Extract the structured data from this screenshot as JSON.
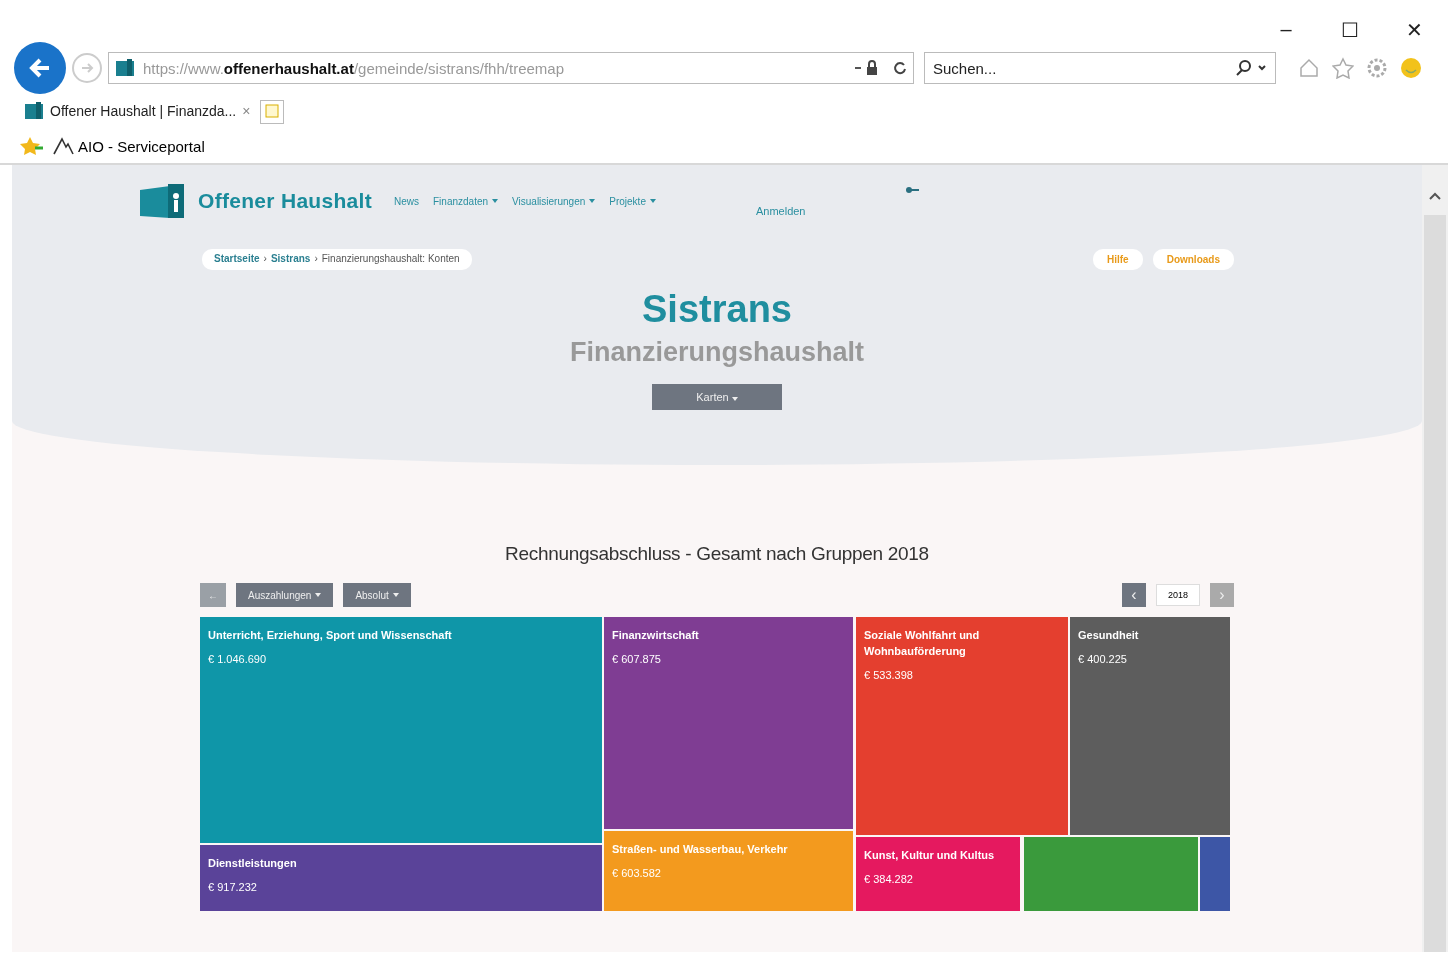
{
  "browser": {
    "window_controls": [
      "–",
      "☐",
      "✕"
    ],
    "url": "https://www.**offenerhaushalt.at**/gemeinde/sistrans/fhh/treemap",
    "search": {
      "placeholder": "Suchen..."
    },
    "tabs": [
      {
        "label": "Offener Haushalt | Finanzda...",
        "close": "×",
        "selected": true
      }
    ],
    "favorites": [
      "AIO - Serviceportal"
    ]
  },
  "site": {
    "logo_text": "Offener Haushalt",
    "nav": [
      {
        "label": "News",
        "dropdown": false
      },
      {
        "label": "Finanzdaten",
        "dropdown": true
      },
      {
        "label": "Visualisierungen",
        "dropdown": true
      },
      {
        "label": "Projekte",
        "dropdown": true
      }
    ],
    "login": "Anmelden",
    "breadcrumb": [
      "Startseite",
      "Sistrans",
      "Finanzierungshaushalt: Konten"
    ],
    "breadcrumb_separator": "›",
    "actions": [
      "Hilfe",
      "Downloads"
    ],
    "title": "Sistrans",
    "subtitle": "Finanzierungshaushalt",
    "view_button": "Karten"
  },
  "chart": {
    "title": "Rechnungsabschluss - Gesamt nach Gruppen 2018",
    "back": "←",
    "filters": [
      "Auszahlungen",
      "Absolut"
    ],
    "year": "2018",
    "prev": "‹",
    "next": "›",
    "tiles": [
      {
        "label": "Unterricht, Erziehung, Sport und Wissenschaft",
        "value": "€ 1.046.690",
        "color": "#0f96a8"
      },
      {
        "label": "Finanzwirtschaft",
        "value": "€ 607.875",
        "color": "#7f3d93"
      },
      {
        "label": "Soziale Wohlfahrt und Wohnbauförderung",
        "value": "€ 533.398",
        "color": "#e43f2f"
      },
      {
        "label": "Gesundheit",
        "value": "€ 400.225",
        "color": "#5d5d5d"
      },
      {
        "label": "Dienstleistungen",
        "value": "€ 917.232",
        "color": "#5a4399"
      },
      {
        "label": "Straßen- und Wasserbau, Verkehr",
        "value": "€ 603.582",
        "color": "#f39a1e"
      },
      {
        "label": "Kunst, Kultur und Kultus",
        "value": "€ 384.282",
        "color": "#e5195f"
      },
      {
        "color": "#3a9a3c"
      },
      {
        "color": "#3d56a6"
      }
    ]
  }
}
